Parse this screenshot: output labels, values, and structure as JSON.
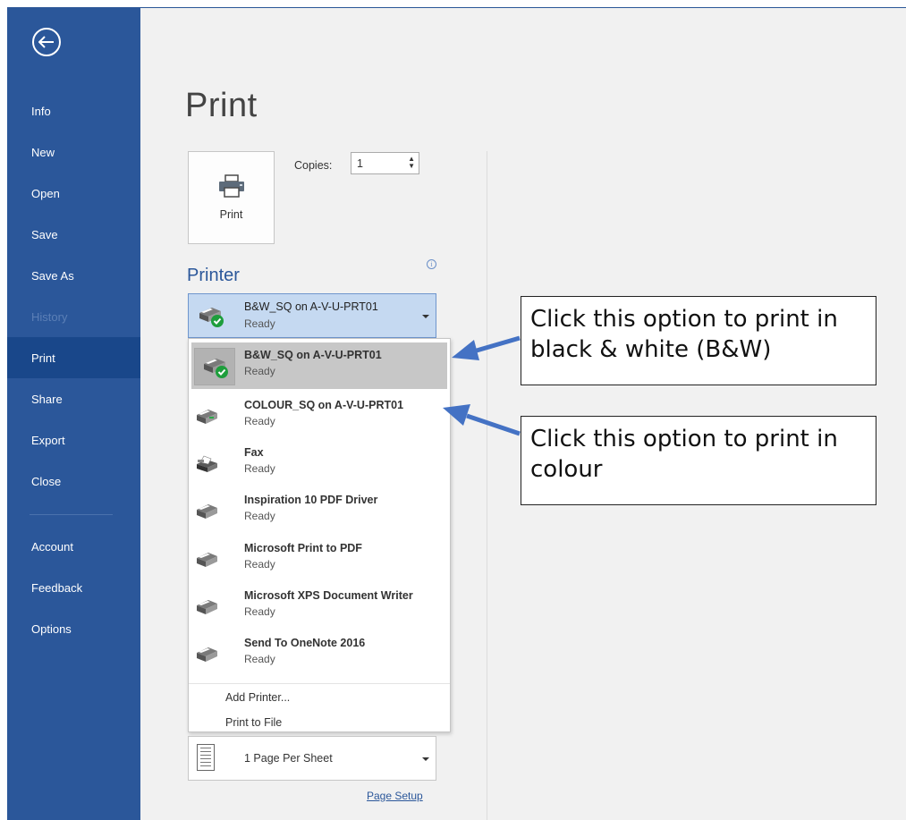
{
  "sidebar": {
    "back_icon": "back-arrow-icon",
    "items": [
      {
        "label": "Info",
        "state": "normal"
      },
      {
        "label": "New",
        "state": "normal"
      },
      {
        "label": "Open",
        "state": "normal"
      },
      {
        "label": "Save",
        "state": "normal"
      },
      {
        "label": "Save As",
        "state": "normal"
      },
      {
        "label": "History",
        "state": "disabled"
      },
      {
        "label": "Print",
        "state": "active"
      },
      {
        "label": "Share",
        "state": "normal"
      },
      {
        "label": "Export",
        "state": "normal"
      },
      {
        "label": "Close",
        "state": "normal"
      },
      {
        "label": "Account",
        "state": "normal"
      },
      {
        "label": "Feedback",
        "state": "normal"
      },
      {
        "label": "Options",
        "state": "normal"
      }
    ]
  },
  "main": {
    "title": "Print",
    "print_button_label": "Print",
    "copies_label": "Copies:",
    "copies_value": "1",
    "printer_section_title": "Printer",
    "selected_printer": {
      "name": "B&W_SQ on A-V-U-PRT01",
      "status": "Ready"
    },
    "printers": [
      {
        "name": "B&W_SQ on A-V-U-PRT01",
        "status": "Ready",
        "icon": "printer-default-icon"
      },
      {
        "name": "COLOUR_SQ on A-V-U-PRT01",
        "status": "Ready",
        "icon": "printer-icon"
      },
      {
        "name": "Fax",
        "status": "Ready",
        "icon": "fax-icon"
      },
      {
        "name": "Inspiration 10 PDF Driver",
        "status": "Ready",
        "icon": "printer-icon"
      },
      {
        "name": "Microsoft Print to PDF",
        "status": "Ready",
        "icon": "printer-icon"
      },
      {
        "name": "Microsoft XPS Document Writer",
        "status": "Ready",
        "icon": "printer-icon"
      },
      {
        "name": "Send To OneNote 2016",
        "status": "Ready",
        "icon": "printer-icon"
      }
    ],
    "add_printer": "Add Printer...",
    "print_to_file": "Print to File",
    "pages_per_sheet": "1 Page Per Sheet",
    "page_setup": "Page Setup"
  },
  "callouts": {
    "bw": "Click this option to print in black & white (B&W)",
    "colour": "Click this option to print in colour"
  },
  "colors": {
    "sidebar": "#2b579a",
    "active": "#19478a",
    "accent": "#2b579a",
    "arrow": "#4472c4"
  }
}
